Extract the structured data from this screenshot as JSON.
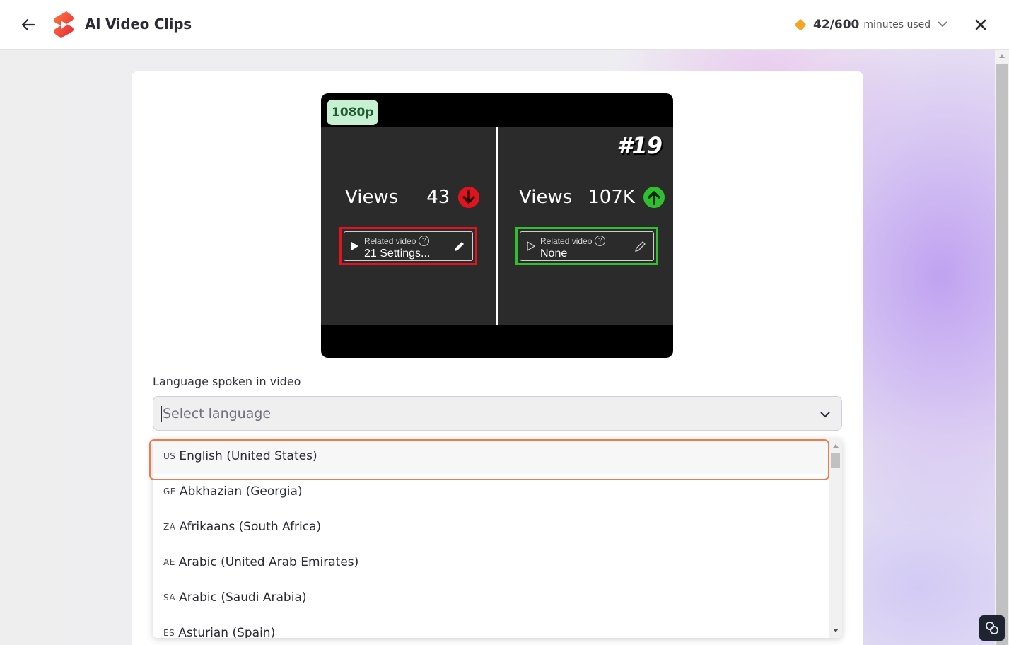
{
  "header": {
    "title": "AI Video Clips",
    "usage_count": "42/600",
    "usage_suffix": "minutes used"
  },
  "preview": {
    "resolution_badge": "1080p",
    "left": {
      "views_label": "Views",
      "views_value": "43",
      "trend": "down",
      "related_label": "Related video",
      "related_value": "21 Settings...",
      "help_glyph": "?"
    },
    "right": {
      "rank": "#19",
      "views_label": "Views",
      "views_value": "107K",
      "trend": "up",
      "related_label": "Related video",
      "related_value": "None",
      "help_glyph": "?"
    }
  },
  "language_field": {
    "label": "Language spoken in video",
    "placeholder": "Select language"
  },
  "language_options": [
    {
      "code": "US",
      "name": "English (United States)"
    },
    {
      "code": "GE",
      "name": "Abkhazian (Georgia)"
    },
    {
      "code": "ZA",
      "name": "Afrikaans (South Africa)"
    },
    {
      "code": "AE",
      "name": "Arabic (United Arab Emirates)"
    },
    {
      "code": "SA",
      "name": "Arabic (Saudi Arabia)"
    },
    {
      "code": "ES",
      "name": "Asturian (Spain)"
    }
  ],
  "colors": {
    "accent_outline": "#f07a4a",
    "trend_down": "#e0141e",
    "trend_up": "#2fbf2f",
    "usage_diamond": "#f5a524"
  }
}
